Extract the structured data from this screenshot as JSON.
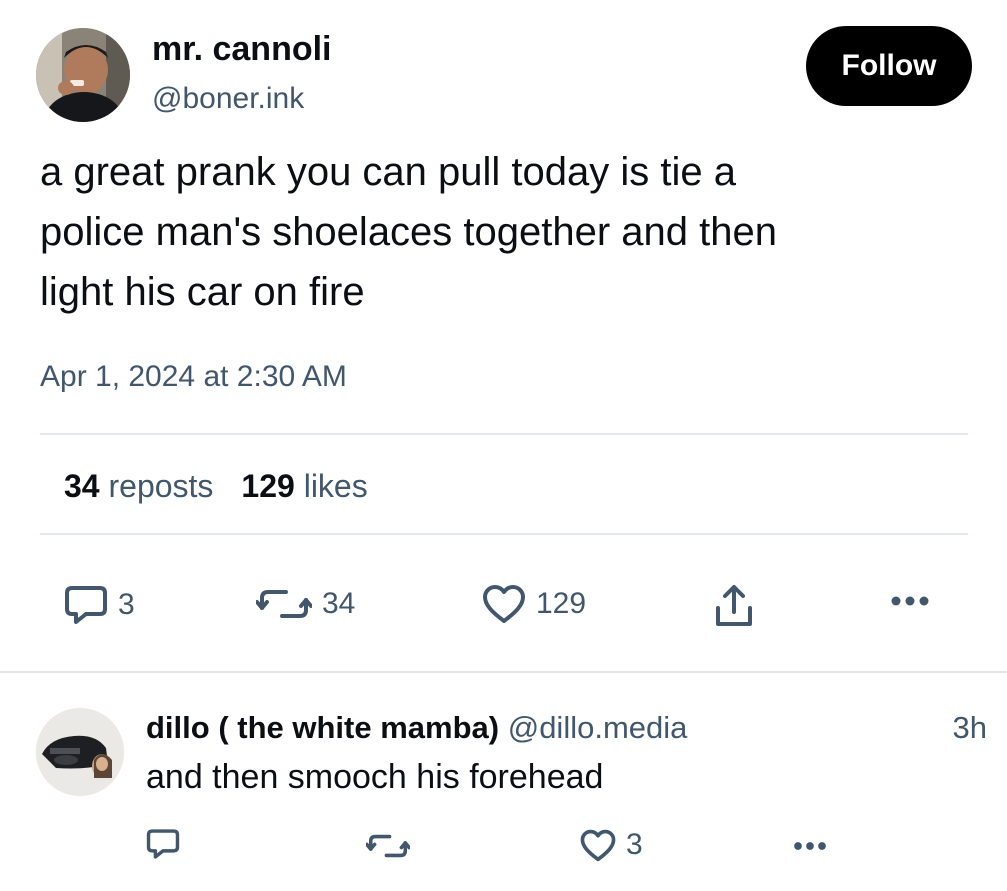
{
  "post": {
    "author": {
      "display_name": "mr. cannoli",
      "handle": "@boner.ink"
    },
    "follow_label": "Follow",
    "text": "a great prank you can pull today is tie a\npolice man's shoelaces together and then\nlight his car on fire",
    "timestamp": "Apr 1, 2024 at 2:30 AM",
    "stats": {
      "reposts_count": "34",
      "reposts_label": "reposts",
      "likes_count": "129",
      "likes_label": "likes"
    },
    "actions": {
      "reply_count": "3",
      "repost_count": "34",
      "like_count": "129"
    }
  },
  "reply": {
    "display_name": "dillo ( the white mamba)",
    "handle": "@dillo.media",
    "time": "3h",
    "text": "and then smooch his forehead",
    "actions": {
      "reply_count": "",
      "repost_count": "",
      "like_count": "3"
    }
  },
  "colors": {
    "text_primary": "#0b0f14",
    "text_secondary": "#42576c",
    "divider": "#e3e7eb",
    "follow_bg": "#000000"
  },
  "icons": [
    "reply-icon",
    "repost-icon",
    "like-icon",
    "share-icon",
    "more-icon"
  ]
}
